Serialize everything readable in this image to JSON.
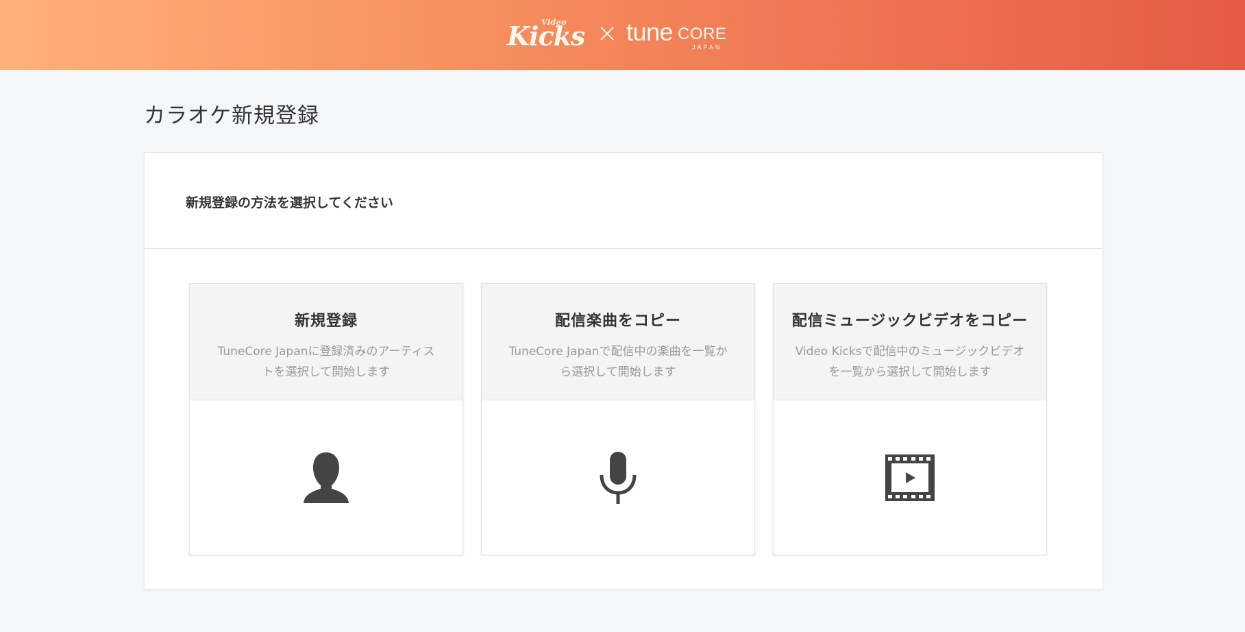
{
  "header": {
    "brand_video": "Video",
    "brand_kicks": "Kicks",
    "brand_cross": "×",
    "brand_tune": "tune",
    "brand_core": "CORE",
    "brand_japan": "JAPAN"
  },
  "page": {
    "title": "カラオケ新規登録",
    "lead": "新規登録の方法を選択してください"
  },
  "options": [
    {
      "title": "新規登録",
      "desc_line1": "TuneCore Japanに登録済みのアーティス",
      "desc_line2": "トを選択して開始します",
      "icon": "person-icon"
    },
    {
      "title": "配信楽曲をコピー",
      "desc_line1": "TuneCore Japanで配信中の楽曲を一覧か",
      "desc_line2": "ら選択して開始します",
      "icon": "microphone-icon"
    },
    {
      "title": "配信ミュージックビデオをコピー",
      "desc_line1": "Video Kicksで配信中のミュージックビデオ",
      "desc_line2": "を一覧から選択して開始します",
      "icon": "film-play-icon"
    }
  ],
  "colors": {
    "header_gradient_start": "#ffb07a",
    "header_gradient_end": "#e55a45",
    "icon": "#444444",
    "background": "#f5f6f7"
  }
}
